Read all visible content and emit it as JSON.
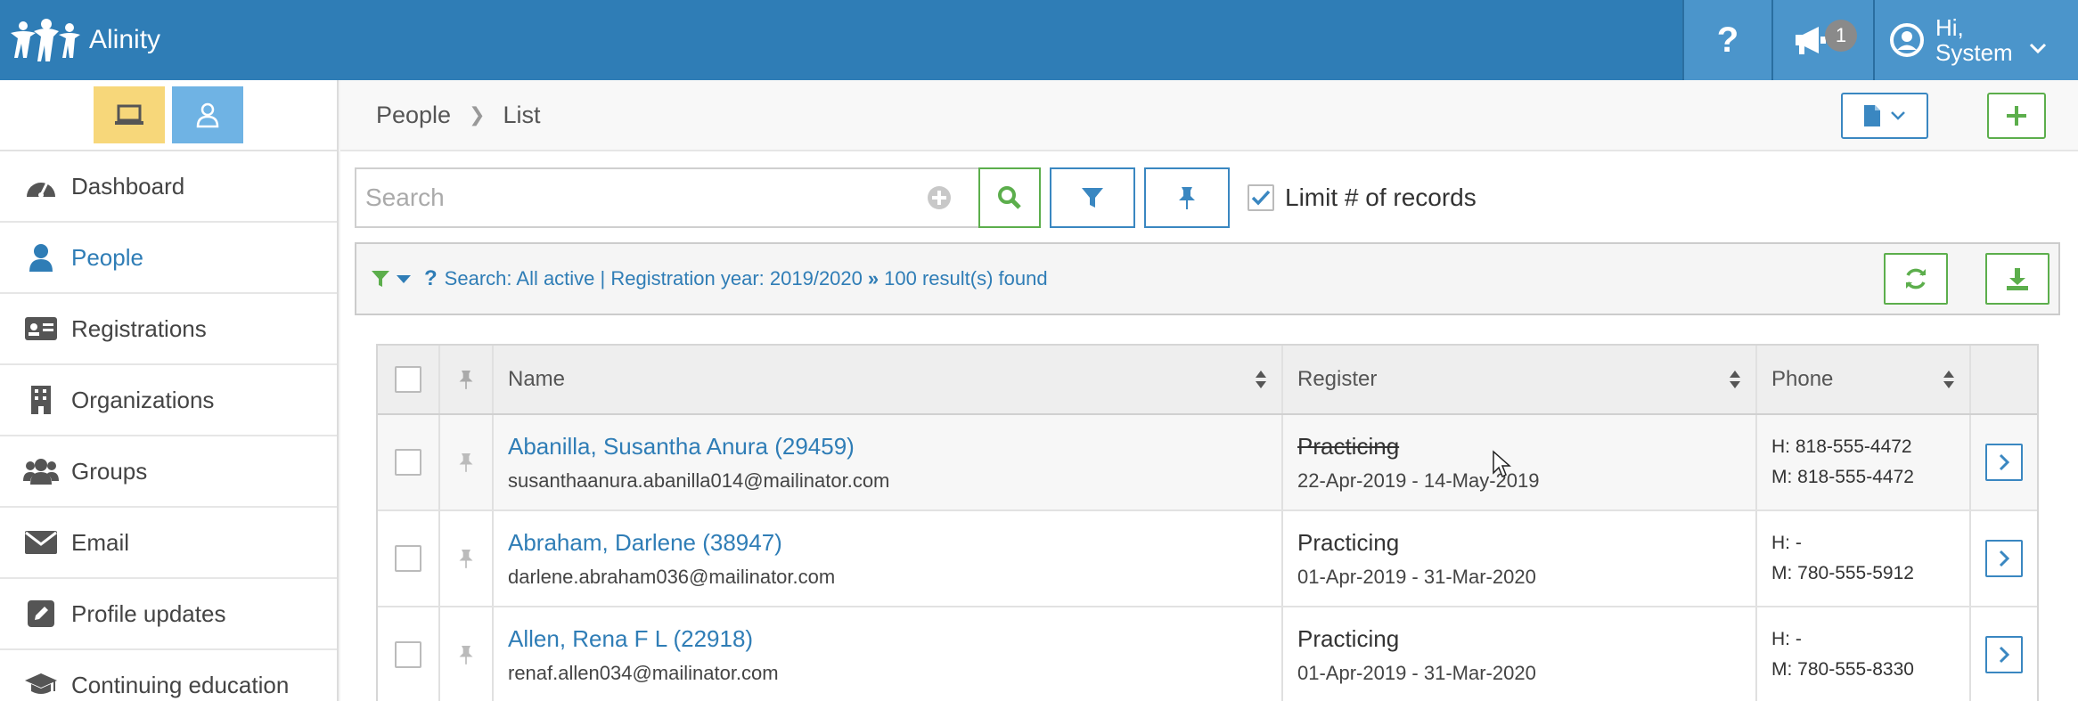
{
  "app": {
    "name": "Alinity"
  },
  "topbar": {
    "help_label": "?",
    "announcements_count": "1",
    "user_greeting": "Hi,",
    "user_name": "System"
  },
  "sidebar": {
    "items": [
      {
        "label": "Dashboard",
        "icon": "dashboard-icon"
      },
      {
        "label": "People",
        "icon": "person-icon",
        "active": true
      },
      {
        "label": "Registrations",
        "icon": "id-card-icon"
      },
      {
        "label": "Organizations",
        "icon": "building-icon"
      },
      {
        "label": "Groups",
        "icon": "users-icon"
      },
      {
        "label": "Email",
        "icon": "envelope-icon"
      },
      {
        "label": "Profile updates",
        "icon": "edit-icon"
      },
      {
        "label": "Continuing education",
        "icon": "graduation-cap-icon"
      }
    ]
  },
  "breadcrumb": {
    "root": "People",
    "current": "List"
  },
  "search": {
    "placeholder": "Search",
    "value": "",
    "limit_label": "Limit # of records",
    "limit_checked": true
  },
  "info": {
    "summary": "Search: All active | Registration year: 2019/2020",
    "results": "100 result(s) found"
  },
  "table": {
    "headers": {
      "name": "Name",
      "register": "Register",
      "phone": "Phone"
    },
    "rows": [
      {
        "name": "Abanilla, Susantha Anura (29459)",
        "email": "susanthaanura.abanilla014@mailinator.com",
        "register": "Practicing",
        "register_struck": true,
        "period": "22-Apr-2019 - 14-May-2019",
        "home": "H:  818-555-4472",
        "mobile": "M: 818-555-4472"
      },
      {
        "name": "Abraham, Darlene (38947)",
        "email": "darlene.abraham036@mailinator.com",
        "register": "Practicing",
        "register_struck": false,
        "period": "01-Apr-2019 - 31-Mar-2020",
        "home": "H:  -",
        "mobile": "M: 780-555-5912"
      },
      {
        "name": "Allen, Rena F L (22918)",
        "email": "renaf.allen034@mailinator.com",
        "register": "Practicing",
        "register_struck": false,
        "period": "01-Apr-2019 - 31-Mar-2020",
        "home": "H:  -",
        "mobile": "M: 780-555-8330"
      }
    ]
  },
  "colors": {
    "brand": "#2f7db6",
    "success": "#5cae4c",
    "desktop_toggle": "#f7d77a",
    "person_toggle": "#6fb3e4"
  }
}
